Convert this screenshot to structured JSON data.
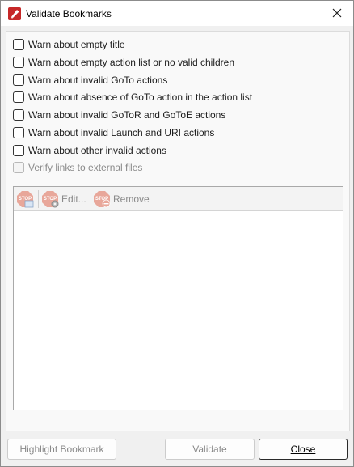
{
  "window": {
    "title": "Validate Bookmarks"
  },
  "options": [
    {
      "label": "Warn about empty title",
      "checked": false,
      "enabled": true
    },
    {
      "label": "Warn about empty action list or no valid children",
      "checked": false,
      "enabled": true
    },
    {
      "label": "Warn about invalid GoTo actions",
      "checked": false,
      "enabled": true
    },
    {
      "label": "Warn about absence of GoTo action in the action list",
      "checked": false,
      "enabled": true
    },
    {
      "label": "Warn about invalid GoToR and GoToE actions",
      "checked": false,
      "enabled": true
    },
    {
      "label": "Warn about invalid Launch and URI actions",
      "checked": false,
      "enabled": true
    },
    {
      "label": "Warn about other invalid actions",
      "checked": false,
      "enabled": true
    },
    {
      "label": "Verify links to external files",
      "checked": false,
      "enabled": false
    }
  ],
  "toolbar": {
    "add_icon": "stop-sign-add-icon",
    "edit_label": "Edit...",
    "edit_icon": "stop-sign-gear-icon",
    "remove_label": "Remove",
    "remove_icon": "stop-sign-minus-icon"
  },
  "buttons": {
    "highlight": "Highlight Bookmark",
    "validate": "Validate",
    "close": "Close"
  },
  "colors": {
    "stop_disabled": "#e8a79a",
    "app_icon_red": "#c62828",
    "focus_border": "#2a2a2a"
  }
}
